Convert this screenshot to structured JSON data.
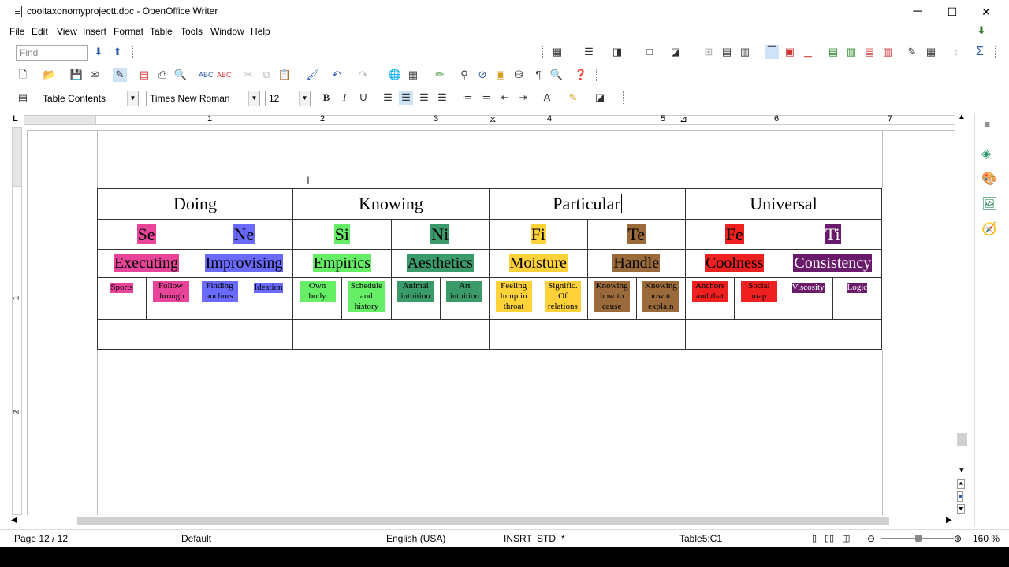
{
  "window": {
    "title": "cooltaxonomyprojectt.doc - OpenOffice Writer",
    "min_label": "─",
    "max_label": "☐",
    "close_label": "✕"
  },
  "menu": [
    "File",
    "Edit",
    "View",
    "Insert",
    "Format",
    "Table",
    "Tools",
    "Window",
    "Help"
  ],
  "find_bar": {
    "placeholder": "Find"
  },
  "formatting": {
    "style": "Table Contents",
    "font": "Times New Roman",
    "size": "12"
  },
  "ruler_numbers": [
    "1",
    "2",
    "3",
    "4",
    "5",
    "6",
    "7"
  ],
  "table": {
    "headers": [
      "Doing",
      "Knowing",
      "Particular",
      "Universal"
    ],
    "functions": [
      {
        "code": "Se",
        "color": "#e8449a"
      },
      {
        "code": "Ne",
        "color": "#6a6aff"
      },
      {
        "code": "Si",
        "color": "#66ee66"
      },
      {
        "code": "Ni",
        "color": "#3a9a6a"
      },
      {
        "code": "Fi",
        "color": "#ffd23a"
      },
      {
        "code": "Te",
        "color": "#9a6a3a"
      },
      {
        "code": "Fe",
        "color": "#ee2020"
      },
      {
        "code": "Ti",
        "color": "#6a1a6a"
      }
    ],
    "names": [
      {
        "label": "Executing",
        "color": "#e8449a",
        "fg": "#000"
      },
      {
        "label": "Improvising",
        "color": "#6a6aff",
        "fg": "#000"
      },
      {
        "label": "Empirics",
        "color": "#66ee66",
        "fg": "#000"
      },
      {
        "label": "Aesthetics",
        "color": "#3a9a6a",
        "fg": "#000"
      },
      {
        "label": "Moisture",
        "color": "#ffd23a",
        "fg": "#000"
      },
      {
        "label": "Handle",
        "color": "#9a6a3a",
        "fg": "#000"
      },
      {
        "label": "Coolness",
        "color": "#ee2020",
        "fg": "#000"
      },
      {
        "label": "Consistency",
        "color": "#6a1a6a",
        "fg": "#fff"
      }
    ],
    "subs": [
      {
        "text": "Sports",
        "color": "#e8449a",
        "fg": "#000"
      },
      {
        "text": "Follow through",
        "color": "#e8449a",
        "fg": "#000"
      },
      {
        "text": "Finding anchors",
        "color": "#6a6aff",
        "fg": "#000"
      },
      {
        "text": "Ideation",
        "color": "#6a6aff",
        "fg": "#000"
      },
      {
        "text": "Own body",
        "color": "#66ee66",
        "fg": "#000"
      },
      {
        "text": "Schedule and history",
        "color": "#66ee66",
        "fg": "#000"
      },
      {
        "text": "Animal intuition",
        "color": "#3a9a6a",
        "fg": "#000"
      },
      {
        "text": "Art intuition",
        "color": "#3a9a6a",
        "fg": "#000"
      },
      {
        "text": "Feeling lump in throat",
        "color": "#ffd23a",
        "fg": "#000"
      },
      {
        "text": "Signific. Of relations",
        "color": "#ffd23a",
        "fg": "#000"
      },
      {
        "text": "Knowing how to cause",
        "color": "#9a6a3a",
        "fg": "#000"
      },
      {
        "text": "Knowing how to explain",
        "color": "#9a6a3a",
        "fg": "#000"
      },
      {
        "text": "Anchors and that",
        "color": "#ee2020",
        "fg": "#000"
      },
      {
        "text": "Social map",
        "color": "#ee2020",
        "fg": "#000"
      },
      {
        "text": "Viscosity",
        "color": "#6a1a6a",
        "fg": "#fff"
      },
      {
        "text": "Logic",
        "color": "#6a1a6a",
        "fg": "#fff"
      }
    ]
  },
  "status": {
    "page": "Page 12 / 12",
    "style": "Default",
    "language": "English (USA)",
    "mode": "INSRT",
    "selection": "STD",
    "modified": "*",
    "cell": "Table5:C1",
    "zoom": "160 %"
  }
}
